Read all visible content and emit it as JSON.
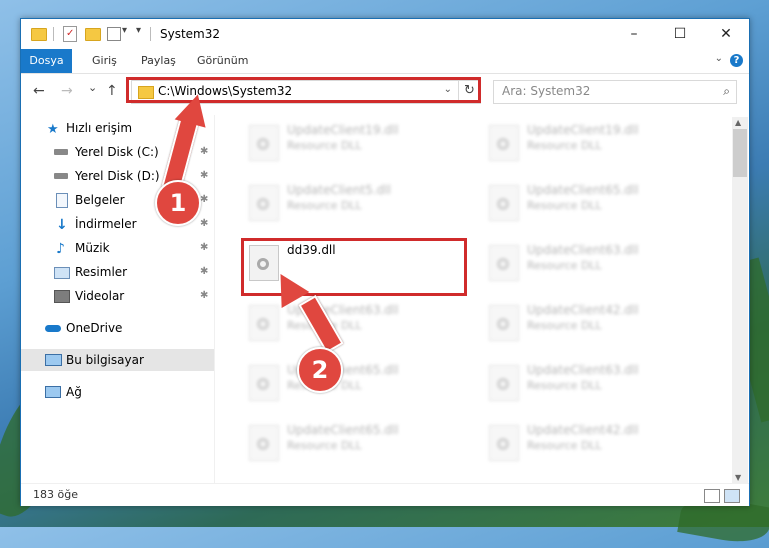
{
  "window": {
    "title": "System32",
    "controls": {
      "minimize": "–",
      "maximize": "☐",
      "close": "✕"
    }
  },
  "ribbon": {
    "tabs": [
      "Dosya",
      "Giriş",
      "Paylaş",
      "Görünüm"
    ],
    "help": "?"
  },
  "navigation": {
    "back": "←",
    "forward": "→",
    "recent": "⌄",
    "up": "↑",
    "address": "C:\\Windows\\System32",
    "refresh": "↻",
    "search_placeholder": "Ara: System32"
  },
  "sidebar": {
    "items": [
      {
        "label": "Hızlı erişim",
        "icon": "star-icon",
        "pinned": false
      },
      {
        "label": "Yerel Disk (C:)",
        "icon": "drive-icon",
        "pinned": true
      },
      {
        "label": "Yerel Disk (D:)",
        "icon": "drive-icon",
        "pinned": true
      },
      {
        "label": "Belgeler",
        "icon": "document-icon",
        "pinned": true
      },
      {
        "label": "İndirmeler",
        "icon": "download-icon",
        "pinned": true
      },
      {
        "label": "Müzik",
        "icon": "music-icon",
        "pinned": true
      },
      {
        "label": "Resimler",
        "icon": "image-icon",
        "pinned": true
      },
      {
        "label": "Videolar",
        "icon": "video-icon",
        "pinned": true
      },
      {
        "label": "OneDrive",
        "icon": "cloud-icon",
        "pinned": false
      },
      {
        "label": "Bu bilgisayar",
        "icon": "computer-icon",
        "pinned": false
      },
      {
        "label": "Ağ",
        "icon": "network-icon",
        "pinned": false
      }
    ],
    "pin_glyph": "✱"
  },
  "files": [
    {
      "name": "UpdateClient19.dll",
      "type": "Resource DLL"
    },
    {
      "name": "UpdateClient19.dll",
      "type": "Resource DLL"
    },
    {
      "name": "UpdateClient5.dll",
      "type": "Resource DLL"
    },
    {
      "name": "UpdateClient65.dll",
      "type": "Resource DLL"
    },
    {
      "name": "dd39.dll",
      "type": ""
    },
    {
      "name": "UpdateClient63.dll",
      "type": "Resource DLL"
    },
    {
      "name": "UpdateClient63.dll",
      "type": "Resource DLL"
    },
    {
      "name": "UpdateClient42.dll",
      "type": "Resource DLL"
    },
    {
      "name": "UpdateClient65.dll",
      "type": "Resource DLL"
    },
    {
      "name": "UpdateClient63.dll",
      "type": "Resource DLL"
    },
    {
      "name": "UpdateClient65.dll",
      "type": "Resource DLL"
    },
    {
      "name": "UpdateClient42.dll",
      "type": "Resource DLL"
    }
  ],
  "status": {
    "count": "183 öğe"
  },
  "annotations": {
    "step1": "1",
    "step2": "2"
  },
  "colors": {
    "accent": "#1979ca",
    "annotation": "#e0473f",
    "highlight": "#d02b2b"
  }
}
